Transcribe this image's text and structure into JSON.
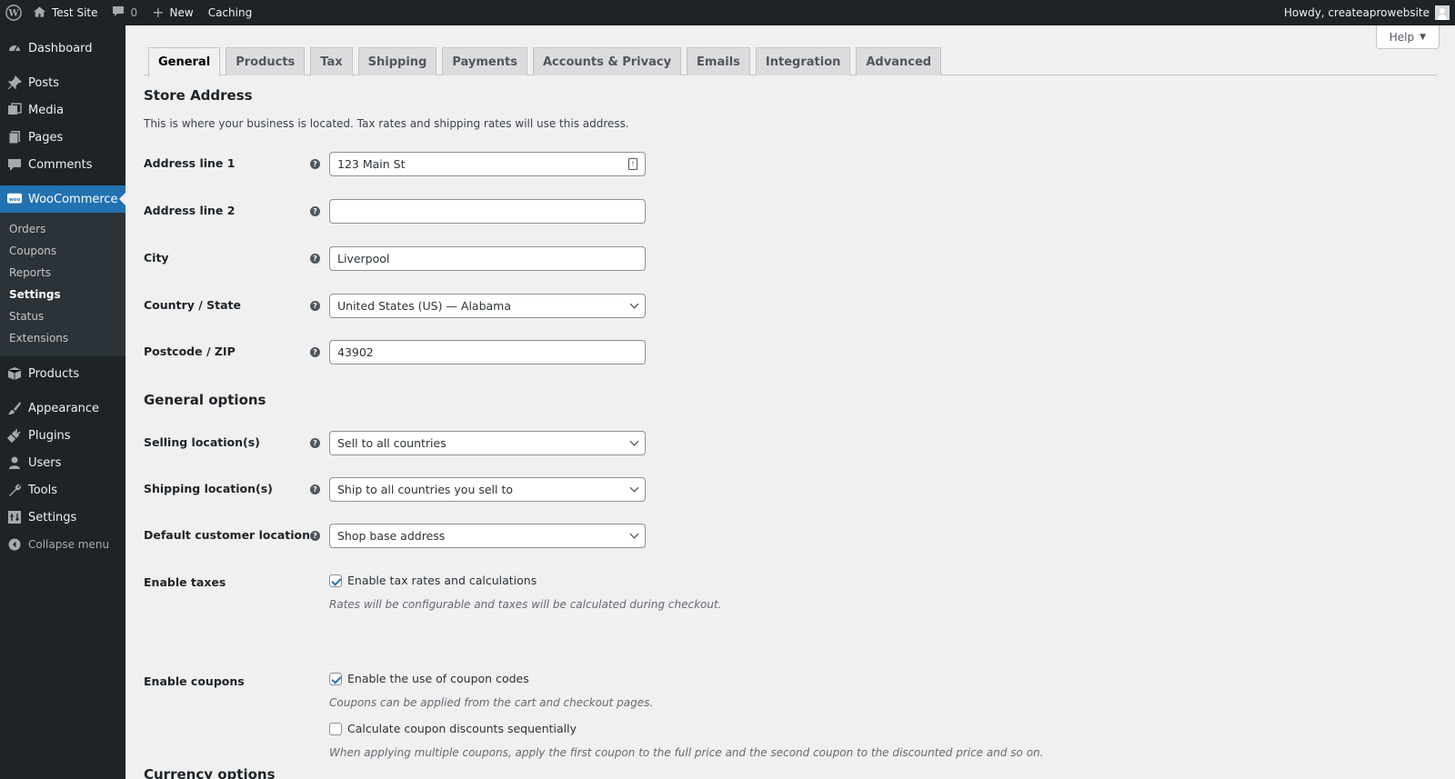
{
  "adminbar": {
    "site_name": "Test Site",
    "comments_count": "0",
    "new_label": "New",
    "caching_label": "Caching",
    "howdy": "Howdy, createaprowebsite"
  },
  "sidebar": {
    "items": [
      {
        "label": "Dashboard",
        "icon": "dashboard-icon"
      },
      {
        "label": "Posts",
        "icon": "pin-icon"
      },
      {
        "label": "Media",
        "icon": "media-icon"
      },
      {
        "label": "Pages",
        "icon": "pages-icon"
      },
      {
        "label": "Comments",
        "icon": "comment-icon"
      },
      {
        "label": "WooCommerce",
        "icon": "woo-icon"
      },
      {
        "label": "Products",
        "icon": "box-icon"
      },
      {
        "label": "Appearance",
        "icon": "brush-icon"
      },
      {
        "label": "Plugins",
        "icon": "plug-icon"
      },
      {
        "label": "Users",
        "icon": "user-icon"
      },
      {
        "label": "Tools",
        "icon": "wrench-icon"
      },
      {
        "label": "Settings",
        "icon": "settings-icon"
      },
      {
        "label": "Collapse menu",
        "icon": "collapse-icon"
      }
    ],
    "woo_submenu": [
      "Orders",
      "Coupons",
      "Reports",
      "Settings",
      "Status",
      "Extensions"
    ]
  },
  "help_label": "Help",
  "tabs": [
    "General",
    "Products",
    "Tax",
    "Shipping",
    "Payments",
    "Accounts & Privacy",
    "Emails",
    "Integration",
    "Advanced"
  ],
  "store_address": {
    "title": "Store Address",
    "description": "This is where your business is located. Tax rates and shipping rates will use this address.",
    "fields": [
      {
        "label": "Address line 1",
        "value": "123 Main St"
      },
      {
        "label": "Address line 2",
        "value": ""
      },
      {
        "label": "City",
        "value": "Liverpool"
      },
      {
        "label": "Country / State",
        "value": "United States (US) — Alabama"
      },
      {
        "label": "Postcode / ZIP",
        "value": "43902"
      }
    ]
  },
  "general_options": {
    "title": "General options",
    "fields": [
      {
        "label": "Selling location(s)",
        "value": "Sell to all countries"
      },
      {
        "label": "Shipping location(s)",
        "value": "Ship to all countries you sell to"
      },
      {
        "label": "Default customer location",
        "value": "Shop base address"
      }
    ],
    "taxes": {
      "label": "Enable taxes",
      "checkbox": "Enable tax rates and calculations",
      "hint": "Rates will be configurable and taxes will be calculated during checkout."
    },
    "coupons": {
      "label": "Enable coupons",
      "checkbox": "Enable the use of coupon codes",
      "hint": "Coupons can be applied from the cart and checkout pages.",
      "seq_checkbox": "Calculate coupon discounts sequentially",
      "seq_hint": "When applying multiple coupons, apply the first coupon to the full price and the second coupon to the discounted price and so on."
    }
  },
  "currency_options": {
    "title": "Currency options"
  }
}
